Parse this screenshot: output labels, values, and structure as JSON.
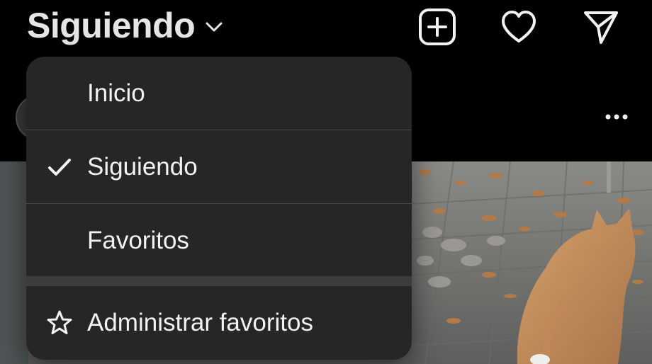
{
  "header": {
    "feed_title": "Siguiendo",
    "icons": [
      "chevron-down-icon",
      "new-post-icon",
      "heart-icon",
      "direct-message-icon"
    ]
  },
  "post": {
    "more_icon": "more-options-icon"
  },
  "menu": {
    "items": [
      {
        "label": "Inicio",
        "checked": false,
        "icon": ""
      },
      {
        "label": "Siguiendo",
        "checked": true,
        "icon": "checkmark-icon"
      },
      {
        "label": "Favoritos",
        "checked": false,
        "icon": ""
      }
    ],
    "manage": {
      "label": "Administrar favoritos",
      "icon": "star-icon"
    }
  },
  "colors": {
    "background": "#000000",
    "menu_background": "#262626",
    "text": "#f2f2f2"
  }
}
